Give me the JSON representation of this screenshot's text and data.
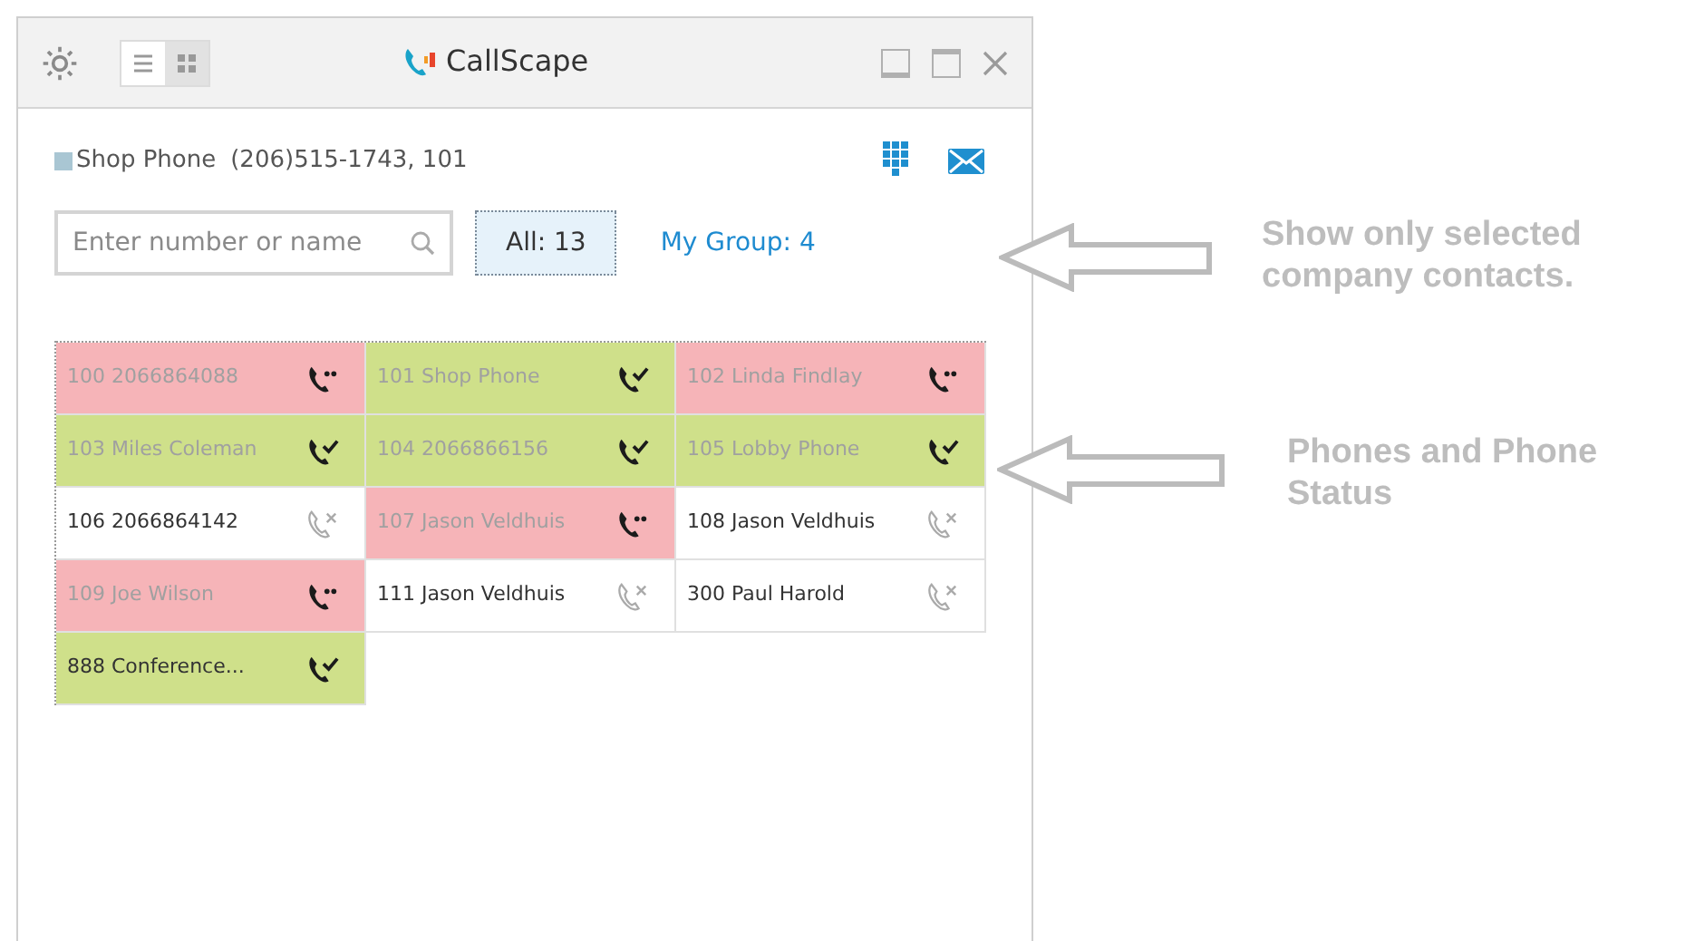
{
  "window": {
    "title": "CallScape"
  },
  "view_toggle": [
    {
      "kind": "list",
      "selected": false
    },
    {
      "kind": "grid",
      "selected": true
    }
  ],
  "account": {
    "name": "Shop Phone",
    "number": "(206)515-1743, 101"
  },
  "search": {
    "placeholder": "Enter number or name"
  },
  "filters": [
    {
      "label": "All: 13",
      "selected": true
    },
    {
      "label": "My Group: 4",
      "selected": false
    }
  ],
  "phones": [
    {
      "label": "100 2066864088",
      "kind": "busy",
      "faded": true
    },
    {
      "label": "101 Shop Phone",
      "kind": "available",
      "faded": true
    },
    {
      "label": "102 Linda Findlay",
      "kind": "busy",
      "faded": true
    },
    {
      "label": "103 Miles Coleman",
      "kind": "available",
      "faded": true
    },
    {
      "label": "104 2066866156",
      "kind": "available",
      "faded": true
    },
    {
      "label": "105 Lobby Phone",
      "kind": "available",
      "faded": true
    },
    {
      "label": "106 2066864142",
      "kind": "offline",
      "faded": false
    },
    {
      "label": "107 Jason Veldhuis",
      "kind": "busy",
      "faded": true
    },
    {
      "label": "108 Jason Veldhuis",
      "kind": "offline",
      "faded": false
    },
    {
      "label": "109 Joe Wilson",
      "kind": "busy",
      "faded": true
    },
    {
      "label": "111 Jason Veldhuis",
      "kind": "offline",
      "faded": false
    },
    {
      "label": "300 Paul Harold",
      "kind": "offline",
      "faded": false
    },
    {
      "label": "888 Conference...",
      "kind": "available",
      "faded": false
    }
  ],
  "annotations": [
    "Show only selected company contacts.",
    "Phones and Phone Status"
  ]
}
